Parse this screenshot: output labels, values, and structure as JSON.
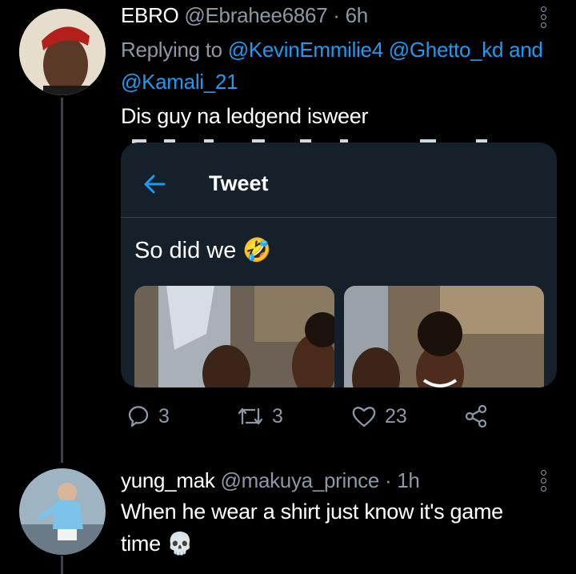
{
  "reply1": {
    "display_name": "EBRO",
    "handle": "@Ebrahee6867",
    "time": "· 6h",
    "replying_prefix": "Replying to",
    "replying_line1": "@KevinEmmilie4 @Ghetto_kd and",
    "replying_line2": "@Kamali_21",
    "text": "Dis guy na ledgend isweer",
    "embedded": {
      "title": "Tweet",
      "text": "So did we 🤣"
    },
    "actions": {
      "replies": "3",
      "retweets": "3",
      "likes": "23"
    }
  },
  "reply2": {
    "display_name": "yung_mak",
    "handle": "@makuya_prince",
    "time": "· 1h",
    "text_line1": "When he wear a shirt just know it's game",
    "text_line2": "time 💀"
  },
  "icons": {
    "more": "more-vertical-icon",
    "back": "arrow-left-icon",
    "reply": "reply-icon",
    "retweet": "retweet-icon",
    "like": "heart-icon",
    "share": "share-icon"
  },
  "colors": {
    "accent": "#1d9bf0",
    "muted": "#8b98a5",
    "card": "#15202b"
  }
}
